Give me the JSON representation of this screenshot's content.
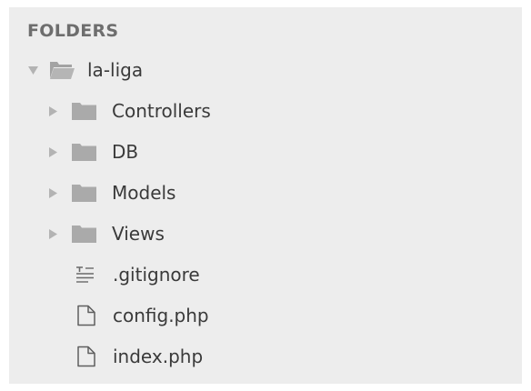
{
  "sidebar": {
    "header": "FOLDERS",
    "root": {
      "label": "la-liga",
      "expanded": true,
      "icon": "folder-open-icon"
    },
    "items": [
      {
        "label": "Controllers",
        "type": "folder",
        "icon": "folder-icon"
      },
      {
        "label": "DB",
        "type": "folder",
        "icon": "folder-icon"
      },
      {
        "label": "Models",
        "type": "folder",
        "icon": "folder-icon"
      },
      {
        "label": "Views",
        "type": "folder",
        "icon": "folder-icon"
      },
      {
        "label": ".gitignore",
        "type": "file",
        "icon": "text-file-icon"
      },
      {
        "label": "config.php",
        "type": "file",
        "icon": "file-icon"
      },
      {
        "label": "index.php",
        "type": "file",
        "icon": "file-icon"
      }
    ]
  },
  "colors": {
    "panel_background": "#ededed",
    "folder_icon": "#aaaaaa",
    "arrow": "#b3b3b3",
    "text": "#3a3a3a",
    "header_text": "#6e6e6e"
  }
}
